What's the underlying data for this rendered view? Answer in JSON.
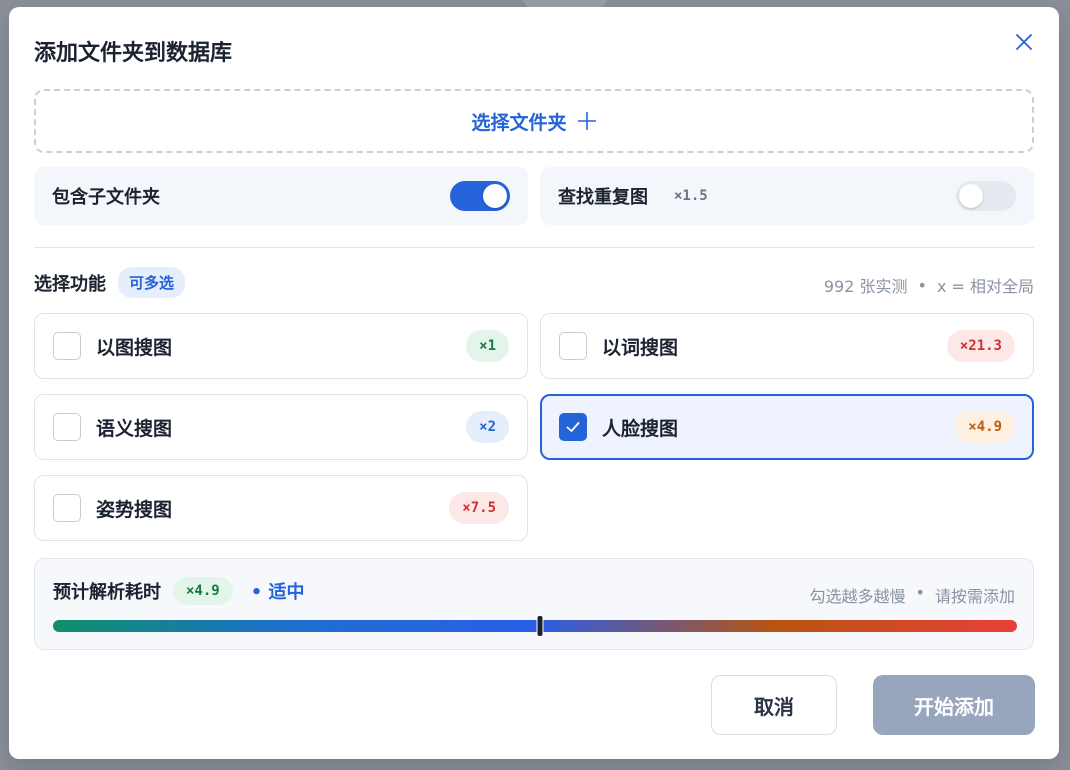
{
  "dialog": {
    "title": "添加文件夹到数据库",
    "close_icon": "close-icon"
  },
  "dropzone": {
    "label": "选择文件夹",
    "icon": "plus-icon"
  },
  "toggles": [
    {
      "label": "包含子文件夹",
      "multiplier": "",
      "enabled": true
    },
    {
      "label": "查找重复图",
      "multiplier": "×1.5",
      "enabled": false
    }
  ],
  "features_section": {
    "title": "选择功能",
    "badge": "可多选",
    "note_count": "992 张实测",
    "note_sep": "•",
    "note_legend": "x = 相对全局"
  },
  "features": [
    {
      "label": "以图搜图",
      "multiplier": "×1",
      "checked": false,
      "badge_bg": "#e3f5ea",
      "badge_fg": "#157a46"
    },
    {
      "label": "以词搜图",
      "multiplier": "×21.3",
      "checked": false,
      "badge_bg": "#fde8e8",
      "badge_fg": "#d42f2f"
    },
    {
      "label": "语义搜图",
      "multiplier": "×2",
      "checked": false,
      "badge_bg": "#e6eefc",
      "badge_fg": "#2563d9"
    },
    {
      "label": "人脸搜图",
      "multiplier": "×4.9",
      "checked": true,
      "badge_bg": "#fdf0e1",
      "badge_fg": "#c05d0a"
    },
    {
      "label": "姿势搜图",
      "multiplier": "×7.5",
      "checked": false,
      "badge_bg": "#fde8e8",
      "badge_fg": "#d42f2f"
    }
  ],
  "estimate": {
    "label": "预计解析耗时",
    "multiplier": "×4.9",
    "level": "• 适中",
    "hint_left": "勾选越多越慢",
    "hint_sep": "•",
    "hint_right": "请按需添加",
    "position_fraction": 0.505
  },
  "buttons": {
    "cancel": "取消",
    "start": "开始添加"
  },
  "colors": {
    "accent": "#2563d9",
    "start_disabled": "#97a6bd"
  }
}
